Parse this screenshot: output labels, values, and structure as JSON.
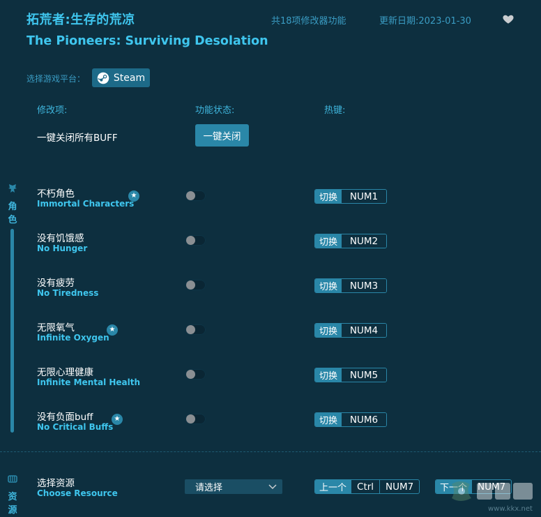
{
  "header": {
    "title_cn": "拓荒者:生存的荒凉",
    "title_en": "The Pioneers: Surviving Desolation",
    "feature_count": "共18项修改器功能",
    "update_date": "更新日期:2023-01-30",
    "favorite_icon": "heart-icon"
  },
  "platform": {
    "label": "选择游戏平台：",
    "selected": "Steam",
    "icon": "steam-icon"
  },
  "columns": {
    "option": "修改项:",
    "status": "功能状态:",
    "hotkey": "热键:"
  },
  "all_off": {
    "label": "一键关闭所有BUFF",
    "button": "一键关闭"
  },
  "categories": [
    {
      "icon": "character-icon",
      "label_chars": [
        "角",
        "色"
      ]
    },
    {
      "icon": "resource-icon",
      "label_chars": [
        "资",
        "源"
      ]
    }
  ],
  "options": [
    {
      "cn": "不朽角色",
      "en": "Immortal Characters",
      "star": true,
      "enabled": false,
      "switch_label": "切换",
      "key": "NUM1"
    },
    {
      "cn": "没有饥饿感",
      "en": "No Hunger",
      "star": false,
      "enabled": false,
      "switch_label": "切换",
      "key": "NUM2"
    },
    {
      "cn": "没有疲劳",
      "en": "No Tiredness",
      "star": false,
      "enabled": false,
      "switch_label": "切换",
      "key": "NUM3"
    },
    {
      "cn": "无限氧气",
      "en": "Infinite Oxygen",
      "star": true,
      "enabled": false,
      "switch_label": "切换",
      "key": "NUM4"
    },
    {
      "cn": "无限心理健康",
      "en": "Infinite Mental Health",
      "star": false,
      "enabled": false,
      "switch_label": "切换",
      "key": "NUM5"
    },
    {
      "cn": "没有负面buff",
      "en": "No Critical Buffs",
      "star": true,
      "enabled": false,
      "switch_label": "切换",
      "key": "NUM6"
    }
  ],
  "resource": {
    "cn": "选择资源",
    "en": "Choose Resource",
    "select_placeholder": "请选择",
    "prev_label": "上一个",
    "prev_keys": [
      "Ctrl",
      "NUM7"
    ],
    "next_label": "下一个",
    "next_keys": [
      "NUM7"
    ]
  },
  "watermark": "www.kkx.net",
  "colors": {
    "background": "#0d2f3f",
    "accent": "#3fc6ee",
    "button": "#2a87a8"
  }
}
